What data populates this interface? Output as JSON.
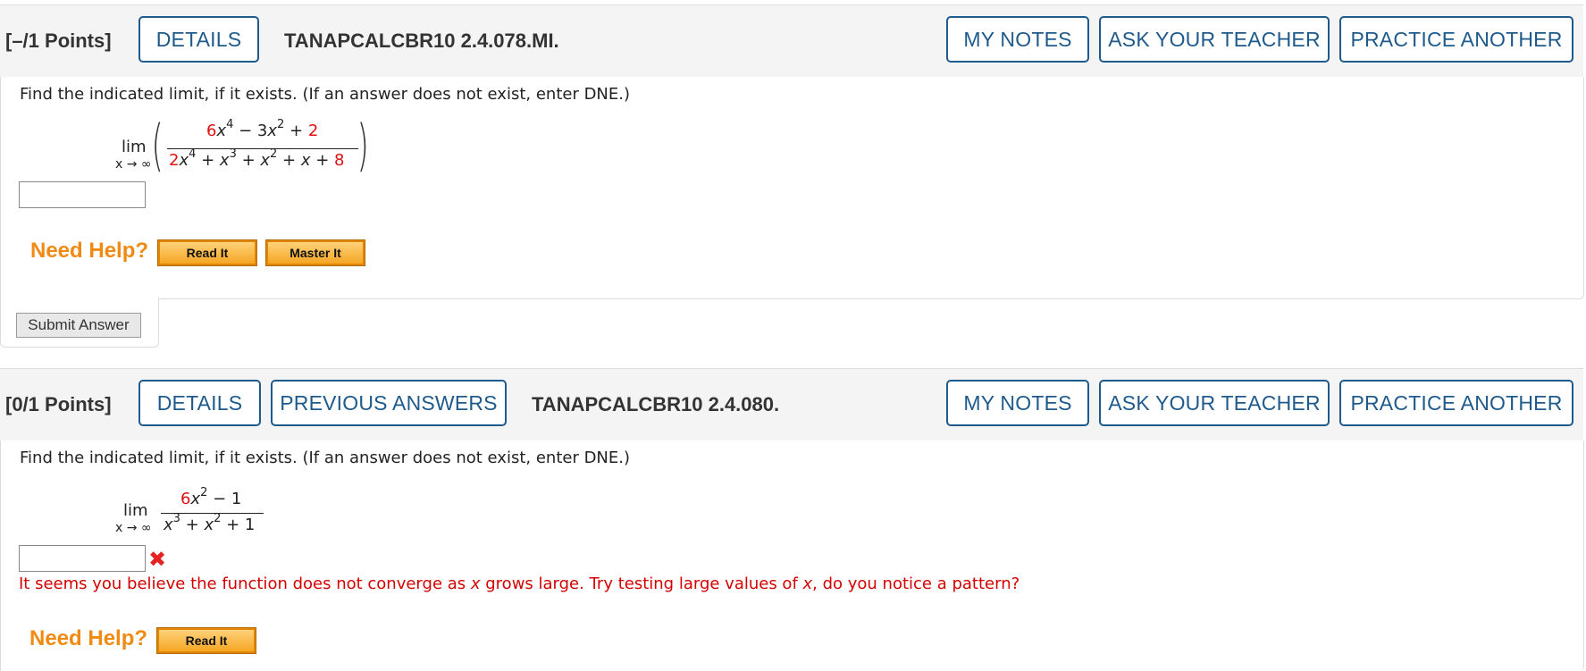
{
  "q1": {
    "points": "[–/1 Points]",
    "details_label": "DETAILS",
    "question_id": "TANAPCALCBR10 2.4.078.MI.",
    "my_notes_label": "MY NOTES",
    "ask_teacher_label": "ASK YOUR TEACHER",
    "practice_label": "PRACTICE ANOTHER",
    "prompt": "Find the indicated limit, if it exists. (If an answer does not exist, enter DNE.)",
    "lim_label": "lim",
    "lim_sub": "x → ∞",
    "answer_value": "",
    "need_help": "Need Help?",
    "read_it": "Read It",
    "master_it": "Master It",
    "submit": "Submit Answer"
  },
  "q2": {
    "points": "[0/1 Points]",
    "details_label": "DETAILS",
    "prev_answers_label": "PREVIOUS ANSWERS",
    "question_id": "TANAPCALCBR10 2.4.080.",
    "my_notes_label": "MY NOTES",
    "ask_teacher_label": "ASK YOUR TEACHER",
    "practice_label": "PRACTICE ANOTHER",
    "prompt": "Find the indicated limit, if it exists. (If an answer does not exist, enter DNE.)",
    "lim_label": "lim",
    "lim_sub": "x → ∞",
    "answer_value": "",
    "feedback_a": "It seems you believe the function does not converge as ",
    "feedback_var": "x",
    "feedback_b": " grows large. Try testing large values of ",
    "feedback_c": ", do you notice a pattern?",
    "need_help": "Need Help?",
    "read_it": "Read It"
  },
  "colors": {
    "accent": "#1f5a8c",
    "help": "#f08a12",
    "error": "#d40000"
  },
  "icons": [
    "close-x-icon"
  ]
}
